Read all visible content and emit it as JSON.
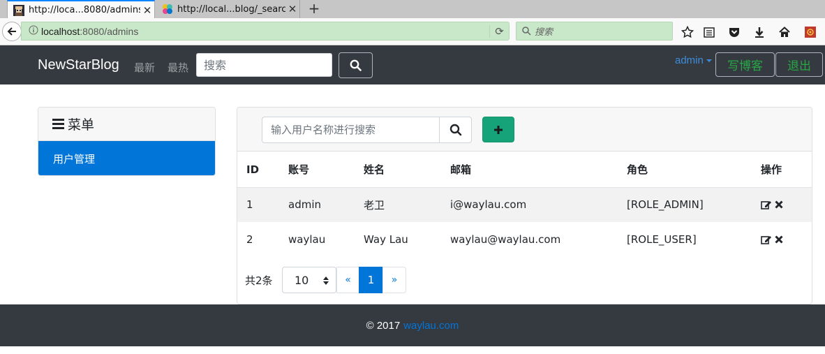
{
  "browser": {
    "tabs": [
      {
        "title": "http://loca...8080/admins",
        "active": true,
        "favicon": "pixel-avatar-icon"
      },
      {
        "title": "http://local...blog/_search",
        "active": false,
        "favicon": "elastic-icon"
      }
    ],
    "new_tab_label": "+",
    "url_host": "localhost",
    "url_rest": ":8080/admins",
    "search_placeholder": "搜索"
  },
  "header": {
    "brand": "NewStarBlog",
    "nav": [
      "最新",
      "最热"
    ],
    "search_placeholder": "搜索",
    "user": "admin",
    "write_label": "写博客",
    "logout_label": "退出"
  },
  "sidebar": {
    "title": "菜单",
    "items": [
      {
        "label": "用户管理",
        "active": true
      }
    ]
  },
  "main": {
    "search_placeholder": "输入用户名称进行搜索",
    "columns": [
      "ID",
      "账号",
      "姓名",
      "邮箱",
      "角色",
      "操作"
    ],
    "rows": [
      {
        "id": "1",
        "account": "admin",
        "name": "老卫",
        "email": "i@waylau.com",
        "role": "[ROLE_ADMIN]"
      },
      {
        "id": "2",
        "account": "waylau",
        "name": "Way Lau",
        "email": "waylau@waylau.com",
        "role": "[ROLE_USER]"
      }
    ],
    "pager": {
      "total_text": "共2条",
      "page_size": "10",
      "prev": "«",
      "current": "1",
      "next": "»"
    }
  },
  "footer": {
    "copyright": "© 2017",
    "link": "waylau.com"
  },
  "colors": {
    "header_bg": "#343a40",
    "primary": "#0275d8",
    "success": "#28a745",
    "add_button": "#17a37a",
    "url_bar": "#c9e8c9"
  }
}
